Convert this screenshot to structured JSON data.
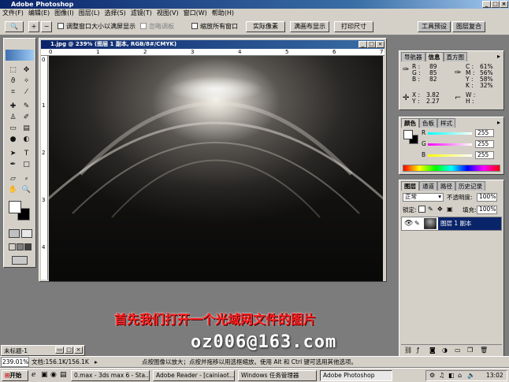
{
  "app": {
    "title": "Adobe Photoshop"
  },
  "menu": [
    "文件(F)",
    "编辑(E)",
    "图像(I)",
    "图层(L)",
    "选择(S)",
    "滤镜(T)",
    "视图(V)",
    "窗口(W)",
    "帮助(H)"
  ],
  "options": {
    "fit_label": "调整窗口大小以满屏显示",
    "ignore_label": "忽略调板",
    "zoom_all_label": "缩放所有窗口",
    "actual_pixels": "实际像素",
    "fit_screen": "满画布显示",
    "print_size": "打印尺寸",
    "tab_presets": "工具预设",
    "tab_comps": "图层复合"
  },
  "document": {
    "title": "1.jpg @ 239% (图层 1 副本, RGB/8#/CMYK)",
    "ruler_top": [
      "0",
      "1",
      "2",
      "3",
      "4",
      "5",
      "6",
      "7"
    ],
    "ruler_left": [
      "0",
      "1",
      "2",
      "3",
      "4"
    ]
  },
  "info_panel": {
    "tabs": [
      "导航器",
      "信息",
      "直方图"
    ],
    "R": "89",
    "G": "85",
    "B": "82",
    "C": "61%",
    "M": "56%",
    "Y": "58%",
    "K": "32%",
    "X": "3.82",
    "Y_coord": "2.27",
    "labels": {
      "R": "R :",
      "G": "G :",
      "B": "B :",
      "C": "C :",
      "M": "M :",
      "Y": "Y :",
      "K": "K :",
      "X": "X :",
      "Yc": "Y :",
      "W": "W :",
      "H": "H :"
    }
  },
  "color_panel": {
    "tabs": [
      "颜色",
      "色板",
      "样式"
    ],
    "R": "255",
    "G": "255",
    "B": "255",
    "labels": {
      "R": "R",
      "G": "G",
      "B": "B"
    }
  },
  "layers_panel": {
    "tabs": [
      "图层",
      "通道",
      "路径",
      "历史记录"
    ],
    "blend_mode": "正常",
    "opacity_label": "不透明度:",
    "opacity": "100%",
    "lock_label": "锁定:",
    "fill_label": "填充:",
    "fill": "100%",
    "layer_name": "图层 1 副本"
  },
  "status": {
    "zoom": "239.01%",
    "doc": "文档:156.1K/156.1K",
    "hint": "点按图像以放大；点按并拖移以用选框缩放。使用 Alt 和 Ctrl 键可选用其他选项。"
  },
  "small_window": {
    "title": "未标题-1"
  },
  "taskbar": {
    "start": "开始",
    "tasks": [
      "0.max - 3ds max 6 - Sta...",
      "Adobe Reader - [cainiaot...",
      "Windows 任务管理器",
      "Adobe Photoshop"
    ],
    "clock": "13:02"
  },
  "captions": {
    "line1": "首先我们打开一个光域网文件的图片",
    "line2": "oz006@163.com"
  },
  "colors": {
    "title_blue": "#0a246a",
    "chrome": "#d4d0c8",
    "caption_red": "#ff2020",
    "layer_selected": "#0a246a"
  }
}
